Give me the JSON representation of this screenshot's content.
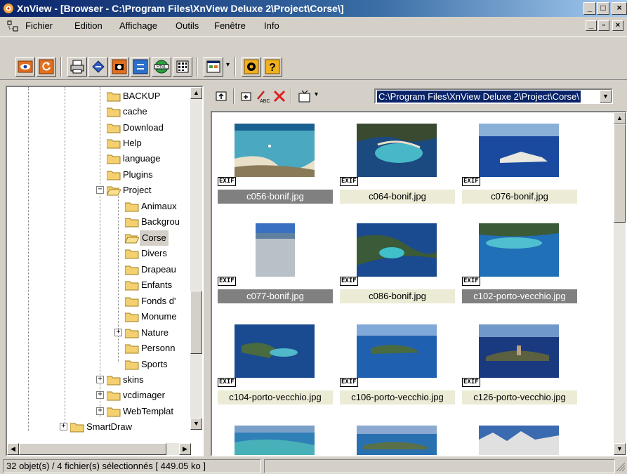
{
  "titlebar": {
    "title": "XnView - [Browser - C:\\Program Files\\XnView Deluxe 2\\Project\\Corse\\]",
    "minimize": "_",
    "maximize": "□",
    "close": "×"
  },
  "menubar": {
    "items": [
      "Fichier",
      "Edition",
      "Affichage",
      "Outils",
      "Fenêtre",
      "Info"
    ]
  },
  "toolbar": {
    "icons": [
      "browse-icon",
      "refresh-icon",
      "print-icon",
      "scan-icon",
      "capture-icon",
      "convert-icon",
      "html-icon",
      "contact-sheet-icon",
      "slideshow-icon",
      "options-icon",
      "help-icon"
    ]
  },
  "tree": {
    "items": [
      {
        "label": "BACKUP"
      },
      {
        "label": "cache"
      },
      {
        "label": "Download"
      },
      {
        "label": "Help"
      },
      {
        "label": "language"
      },
      {
        "label": "Plugins"
      },
      {
        "label": "Project"
      },
      {
        "label": "Animaux"
      },
      {
        "label": "Backgrou"
      },
      {
        "label": "Corse"
      },
      {
        "label": "Divers"
      },
      {
        "label": "Drapeau"
      },
      {
        "label": "Enfants"
      },
      {
        "label": "Fonds d'"
      },
      {
        "label": "Monume"
      },
      {
        "label": "Nature"
      },
      {
        "label": "Personn"
      },
      {
        "label": "Sports"
      },
      {
        "label": "skins"
      },
      {
        "label": "vcdimager"
      },
      {
        "label": "WebTemplat"
      },
      {
        "label": "SmartDraw"
      }
    ],
    "expanders": {
      "project": "−",
      "nature": "+",
      "skins": "+",
      "vcdimager": "+",
      "webtemplat": "+",
      "smartdraw": "+"
    }
  },
  "browser": {
    "path": "C:\\Program Files\\XnView Deluxe 2\\Project\\Corse\\"
  },
  "thumbnails": [
    {
      "name": "c056-bonif.jpg",
      "exif": "EXIF",
      "selected": true
    },
    {
      "name": "c064-bonif.jpg",
      "exif": "EXIF",
      "selected": false
    },
    {
      "name": "c076-bonif.jpg",
      "exif": "EXIF",
      "selected": false
    },
    {
      "name": "c077-bonif.jpg",
      "exif": "EXIF",
      "selected": true
    },
    {
      "name": "c086-bonif.jpg",
      "exif": "EXIF",
      "selected": false
    },
    {
      "name": "c102-porto-vecchio.jpg",
      "exif": "EXIF",
      "selected": true
    },
    {
      "name": "c104-porto-vecchio.jpg",
      "exif": "EXIF",
      "selected": false
    },
    {
      "name": "c106-porto-vecchio.jpg",
      "exif": "EXIF",
      "selected": false
    },
    {
      "name": "c126-porto-vecchio.jpg",
      "exif": "EXIF",
      "selected": false
    }
  ],
  "status": {
    "text": "32 objet(s) / 4 fichier(s) sélectionnés  [ 449.05 ko ]"
  },
  "colors": {
    "titlebar_start": "#0a246a",
    "selection": "#0a246a",
    "caption_bg": "#ecebd6",
    "caption_selected_bg": "#808080"
  }
}
